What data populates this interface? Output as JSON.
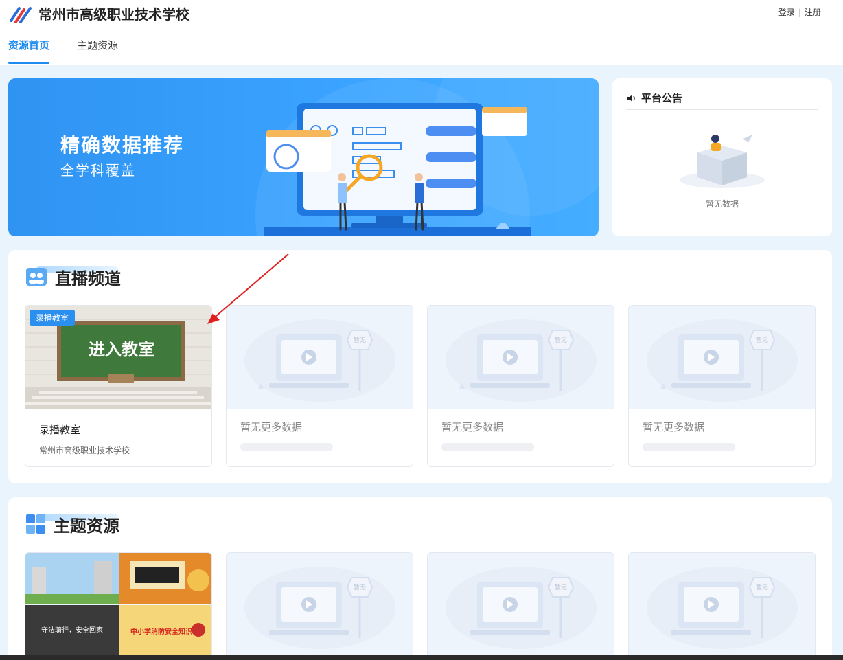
{
  "header": {
    "school_name": "常州市高级职业技术学校",
    "login": "登录",
    "separator": "|",
    "register": "注册"
  },
  "nav": {
    "tabs": [
      {
        "label": "资源首页",
        "active": true
      },
      {
        "label": "主题资源",
        "active": false
      }
    ]
  },
  "banner": {
    "title": "精确数据推荐",
    "subtitle": "全学科覆盖"
  },
  "notice": {
    "title": "平台公告",
    "empty_text": "暂无数据"
  },
  "live_section": {
    "title": "直播频道",
    "cards": [
      {
        "badge": "录播教室",
        "thumb_text": "进入教室",
        "title": "录播教室",
        "subtitle": "常州市高级职业技术学校"
      },
      {
        "empty_text": "暂无更多数据",
        "sign_text": "暂无"
      },
      {
        "empty_text": "暂无更多数据",
        "sign_text": "暂无"
      },
      {
        "empty_text": "暂无更多数据",
        "sign_text": "暂无"
      }
    ]
  },
  "topic_section": {
    "title": "主题资源",
    "cards": [
      {
        "thumb_texts": [
          "守法骑行，安全回家",
          "中小学消防安全知识"
        ]
      },
      {
        "sign_text": "暂无"
      },
      {
        "sign_text": "暂无"
      },
      {
        "sign_text": "暂无"
      }
    ]
  },
  "colors": {
    "accent": "#1e8bf0",
    "background": "#eaf4fd",
    "banner_blue": "#3aa3ff",
    "annotation_arrow": "#e02020"
  }
}
